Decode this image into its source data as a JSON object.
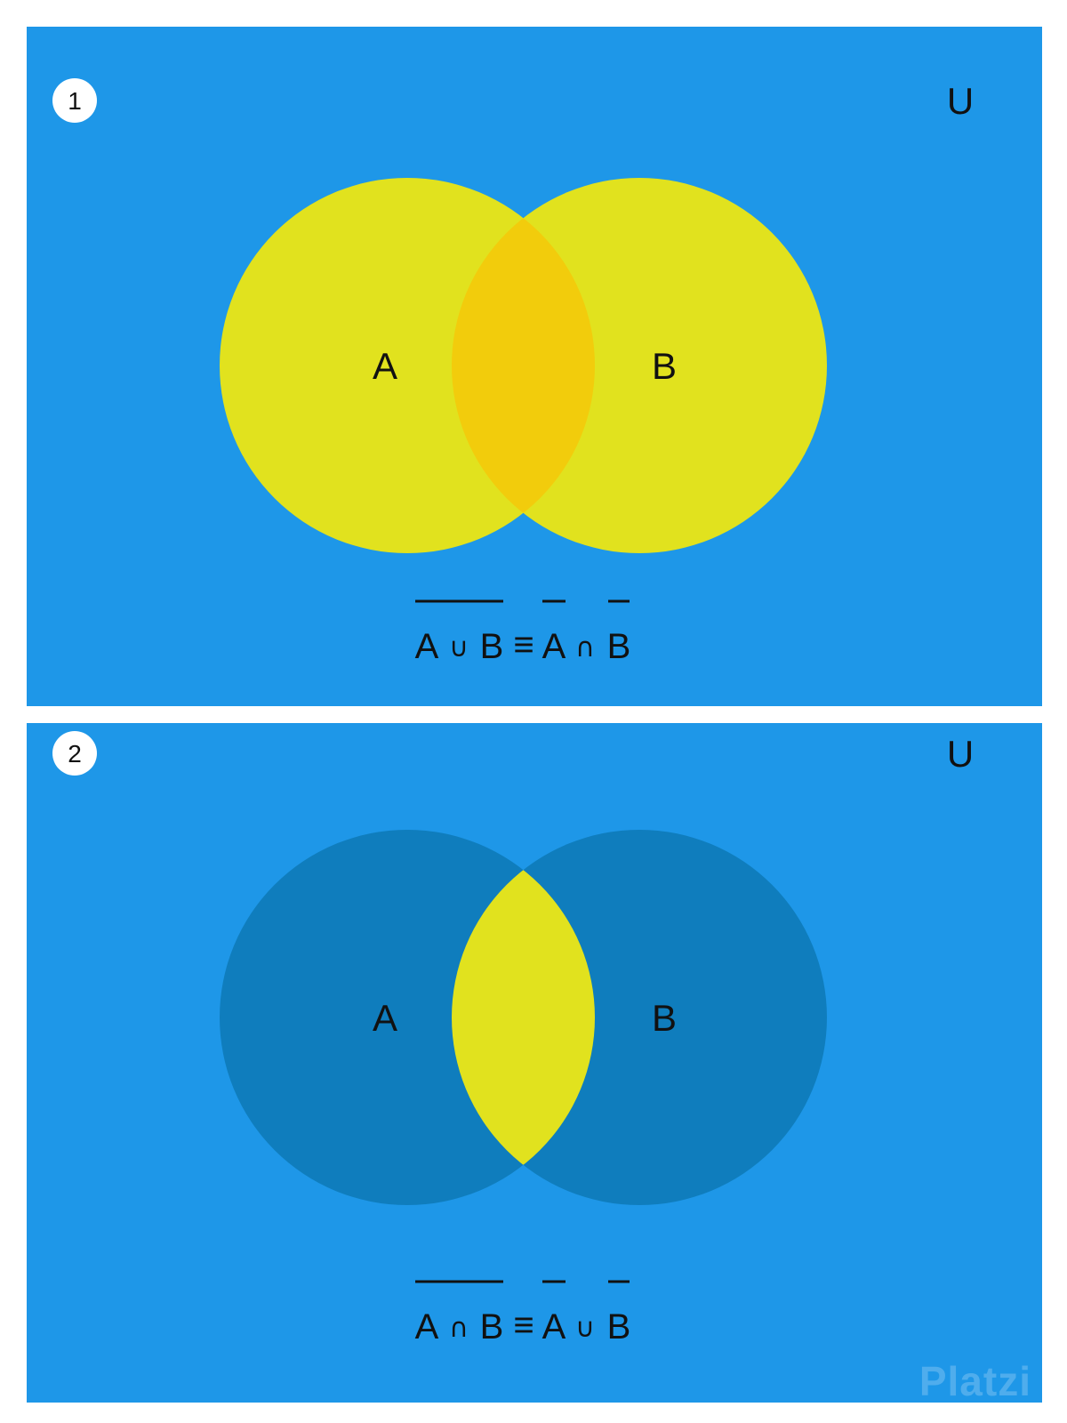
{
  "colors": {
    "background": "#1e97e8",
    "set_fill": "#e1e21e",
    "overlap_fill": "#f2cc0c",
    "set_dark_fill": "#0f7dbd",
    "text": "#111111",
    "badge": "#ffffff"
  },
  "panels": [
    {
      "number": "1",
      "universe_label": "U",
      "set_a_label": "A",
      "set_b_label": "B",
      "equation": {
        "left_a": "A",
        "left_op": "∪",
        "left_b": "B",
        "equiv": "≡",
        "right_a": "A",
        "right_op": "∩",
        "right_b": "B"
      }
    },
    {
      "number": "2",
      "universe_label": "U",
      "set_a_label": "A",
      "set_b_label": "B",
      "equation": {
        "left_a": "A",
        "left_op": "∩",
        "left_b": "B",
        "equiv": "≡",
        "right_a": "A",
        "right_op": "∪",
        "right_b": "B"
      }
    }
  ],
  "watermark": "Platzi"
}
